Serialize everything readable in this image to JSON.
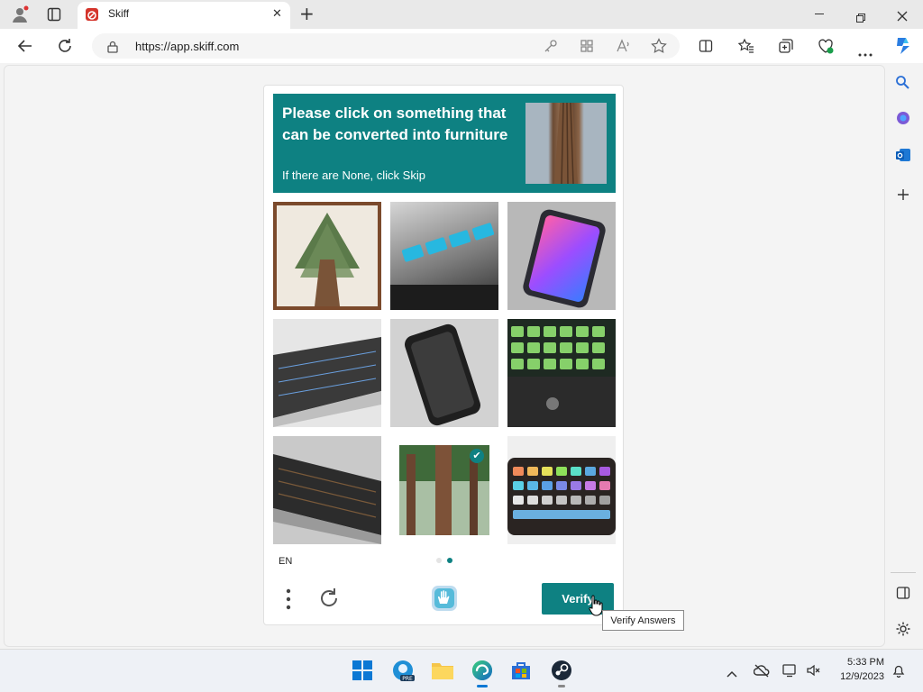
{
  "browser": {
    "tab_title": "Skiff",
    "url": "https://app.skiff.com",
    "new_tab_symbol": "+",
    "close_tab_symbol": "✕"
  },
  "captcha": {
    "prompt_title": "Please click on something that can be converted into furniture",
    "prompt_subtitle": "If there are None, click Skip",
    "language": "EN",
    "verify_label": "Verify",
    "verify_tooltip": "Verify Answers",
    "page_indicator": {
      "total": 2,
      "current": 2
    },
    "tiles": [
      {
        "subject": "framed-tree-painting",
        "selected": false
      },
      {
        "subject": "blue-keyboard-keys",
        "selected": false
      },
      {
        "subject": "smartphone",
        "selected": false
      },
      {
        "subject": "silver-keyboard",
        "selected": false
      },
      {
        "subject": "black-phone",
        "selected": false
      },
      {
        "subject": "green-keyboard",
        "selected": false
      },
      {
        "subject": "black-keyboard",
        "selected": false
      },
      {
        "subject": "redwood-tree",
        "selected": true
      },
      {
        "subject": "rgb-keyboard",
        "selected": false
      }
    ]
  },
  "taskbar": {
    "time": "5:33 PM",
    "date": "12/9/2023"
  },
  "colors": {
    "accent": "#0e8182"
  }
}
